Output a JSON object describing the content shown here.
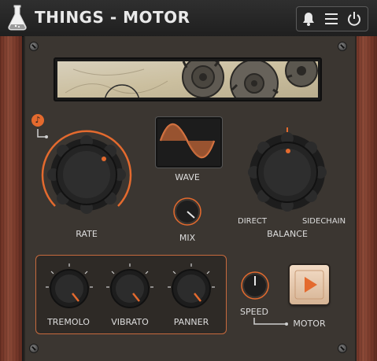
{
  "header": {
    "title": "THINGS - MOTOR",
    "icons": [
      "flask-logo-icon",
      "bell-icon",
      "menu-icon",
      "power-icon"
    ]
  },
  "controls": {
    "rate_label": "RATE",
    "wave_label": "WAVE",
    "mix_label": "MIX",
    "balance_label": "BALANCE",
    "balance_left": "DIRECT",
    "balance_right": "SIDECHAIN",
    "tremolo_label": "TREMOLO",
    "vibrato_label": "VIBRATO",
    "panner_label": "PANNER",
    "speed_label": "SPEED",
    "motor_label": "MOTOR"
  },
  "colors": {
    "accent": "#e46a2e",
    "panel": "#3b3631",
    "text": "#dddddd"
  }
}
